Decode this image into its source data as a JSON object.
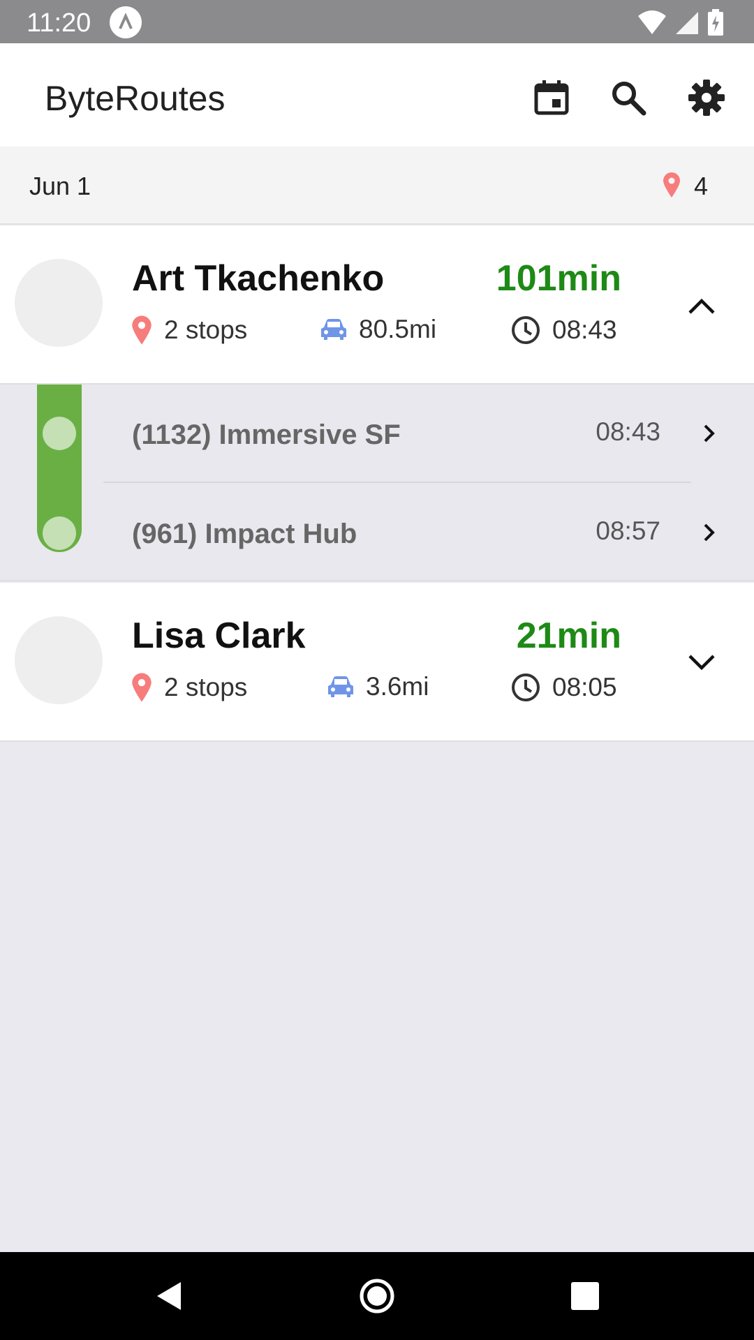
{
  "status_bar": {
    "time": "11:20"
  },
  "app_bar": {
    "title": "ByteRoutes"
  },
  "date_bar": {
    "date": "Jun 1",
    "stop_count": "4"
  },
  "drivers": [
    {
      "name": "Art Tkachenko",
      "duration": "101min",
      "stops": "2 stops",
      "distance": "80.5mi",
      "start_time": "08:43",
      "expanded": true,
      "stop_list": [
        {
          "name": "(1132) Immersive SF",
          "time": "08:43"
        },
        {
          "name": "(961) Impact Hub",
          "time": "08:57"
        }
      ]
    },
    {
      "name": "Lisa Clark",
      "duration": "21min",
      "stops": "2 stops",
      "distance": "3.6mi",
      "start_time": "08:05",
      "expanded": false
    }
  ],
  "colors": {
    "accent_green": "#1e8a16",
    "route_green": "#6aaf44",
    "pin_red": "#f77c7c",
    "car_blue": "#6f95e8"
  }
}
